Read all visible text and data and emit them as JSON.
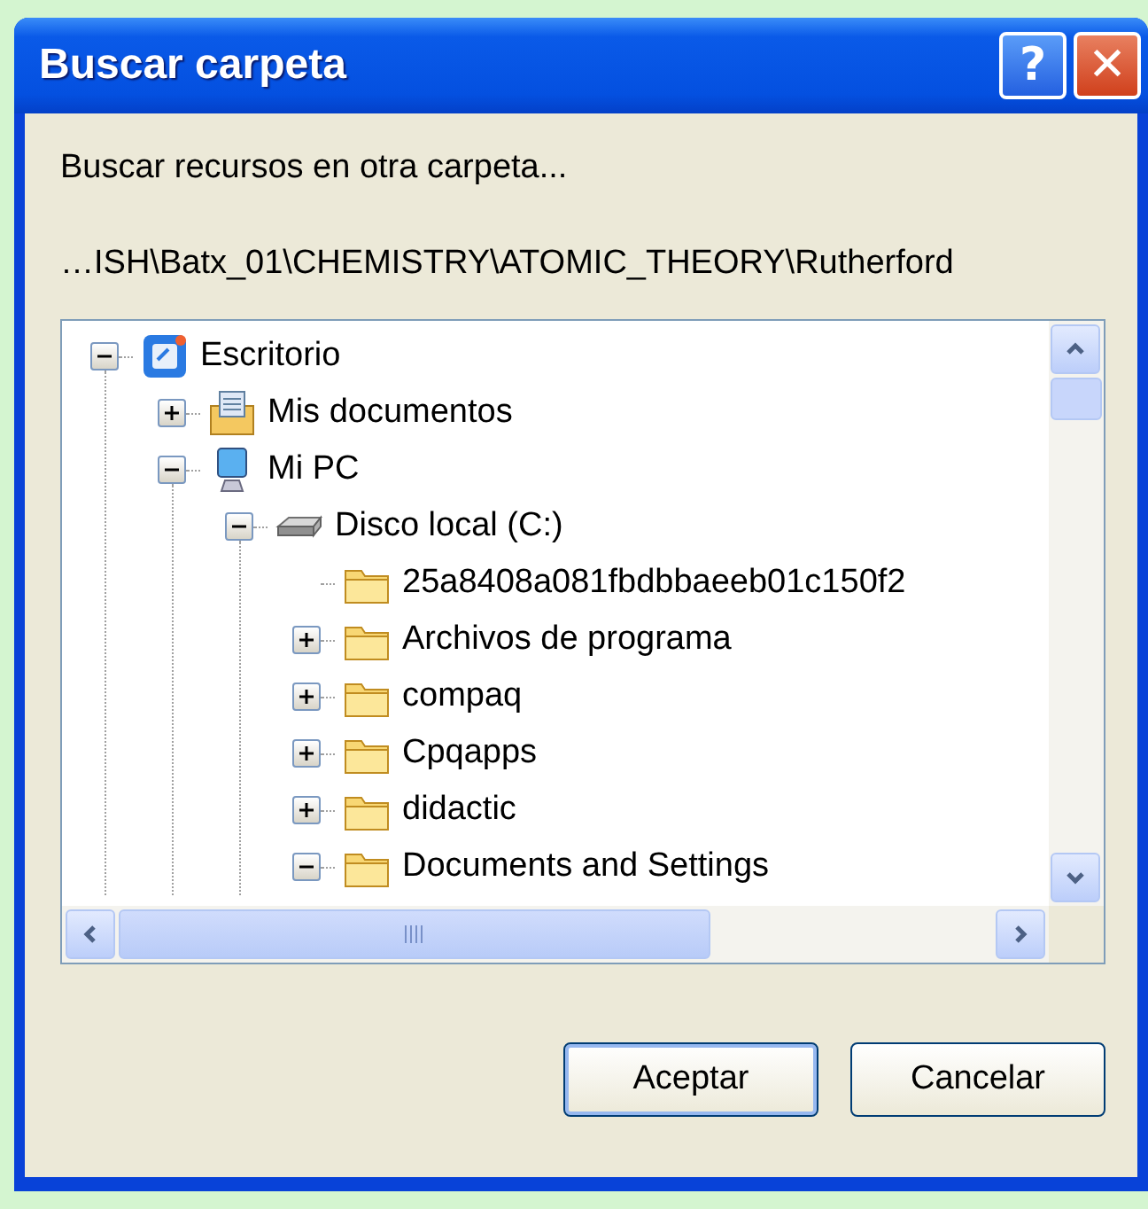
{
  "window": {
    "title": "Buscar carpeta",
    "buttons": [
      {
        "kind": "help",
        "label": "?"
      },
      {
        "kind": "close",
        "label": "✕"
      }
    ]
  },
  "description": "Buscar recursos en otra carpeta...",
  "path": "…ISH\\Batx_01\\CHEMISTRY\\ATOMIC_THEORY\\Rutherford",
  "tree": [
    {
      "label": "Escritorio",
      "kind": "desktop",
      "expanded": true,
      "children": [
        {
          "label": "Mis documentos",
          "kind": "documents",
          "expanded": false
        },
        {
          "label": "Mi PC",
          "kind": "computer",
          "expanded": true,
          "children": [
            {
              "label": "Disco local (C:)",
              "kind": "drive",
              "expanded": true,
              "children": [
                {
                  "label": "25a8408a081fbdbbaeeb01c150f2",
                  "kind": "folder"
                },
                {
                  "label": "Archivos de programa",
                  "kind": "folder",
                  "expanded": false
                },
                {
                  "label": "compaq",
                  "kind": "folder",
                  "expanded": false
                },
                {
                  "label": "Cpqapps",
                  "kind": "folder",
                  "expanded": false
                },
                {
                  "label": "didactic",
                  "kind": "folder",
                  "expanded": false
                },
                {
                  "label": "Documents and Settings",
                  "kind": "folder",
                  "expanded": true
                }
              ]
            }
          ]
        }
      ]
    }
  ],
  "buttons": [
    {
      "label": "Aceptar",
      "default": true
    },
    {
      "label": "Cancelar",
      "default": false
    }
  ]
}
